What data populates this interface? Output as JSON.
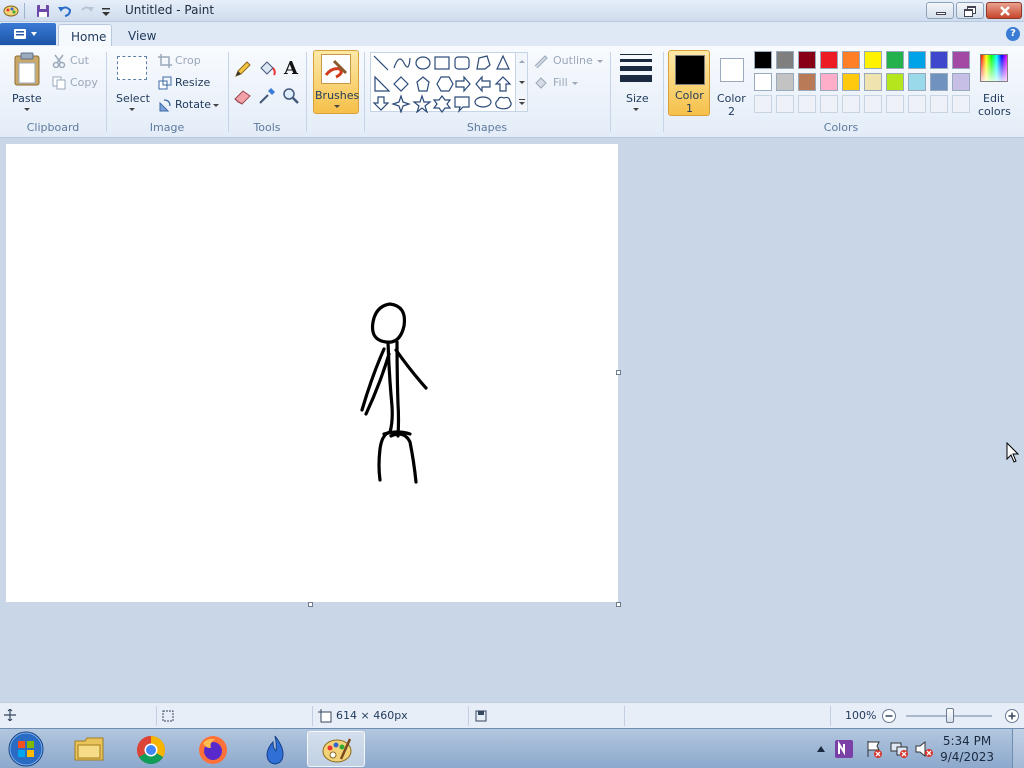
{
  "window": {
    "title": "Untitled - Paint"
  },
  "tabs": [
    {
      "label": "Home"
    },
    {
      "label": "View"
    }
  ],
  "clipboard": {
    "paste": "Paste",
    "cut": "Cut",
    "copy": "Copy",
    "group": "Clipboard"
  },
  "image": {
    "select": "Select",
    "crop": "Crop",
    "resize": "Resize",
    "rotate": "Rotate",
    "group": "Image"
  },
  "tools": {
    "group": "Tools",
    "text_tool": "A"
  },
  "brushes": {
    "label": "Brushes"
  },
  "shapes": {
    "group": "Shapes",
    "outline": "Outline",
    "fill": "Fill"
  },
  "size": {
    "label": "Size"
  },
  "colors": {
    "group": "Colors",
    "color1_line1": "Color",
    "color1_line2": "1",
    "color2_line1": "Color",
    "color2_line2": "2",
    "edit_line1": "Edit",
    "edit_line2": "colors",
    "color1": "#000000",
    "color2": "#ffffff",
    "palette_row1": [
      "#000000",
      "#7f7f7f",
      "#880015",
      "#ed1c24",
      "#ff7f27",
      "#fff200",
      "#22b14c",
      "#00a2e8",
      "#3f48cc",
      "#a349a4"
    ],
    "palette_row2": [
      "#ffffff",
      "#c3c3c3",
      "#b97a57",
      "#ffaec9",
      "#ffc90e",
      "#efe4b0",
      "#b5e61d",
      "#99d9ea",
      "#7092be",
      "#c8bfe7"
    ]
  },
  "status": {
    "dimensions": "614 × 460px",
    "zoom": "100%"
  },
  "clock": {
    "time": "5:34 PM",
    "date": "9/4/2023"
  }
}
